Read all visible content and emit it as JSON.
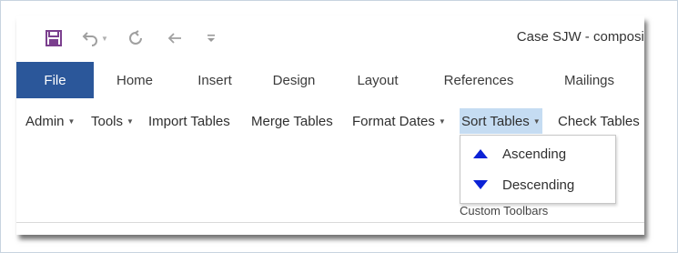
{
  "quick_access": {
    "title": "Case SJW - composit"
  },
  "tabs": [
    {
      "label": "File"
    },
    {
      "label": "Home"
    },
    {
      "label": "Insert"
    },
    {
      "label": "Design"
    },
    {
      "label": "Layout"
    },
    {
      "label": "References"
    },
    {
      "label": "Mailings"
    }
  ],
  "toolbar": {
    "items": [
      {
        "label": "Admin"
      },
      {
        "label": "Tools"
      },
      {
        "label": "Import Tables"
      },
      {
        "label": "Merge Tables"
      },
      {
        "label": "Format Dates"
      },
      {
        "label": "Sort Tables"
      },
      {
        "label": "Check Tables"
      }
    ],
    "group_label": "Custom Toolbars"
  },
  "sort_menu": {
    "items": [
      {
        "label": "Ascending",
        "icon": "triangle-up-icon"
      },
      {
        "label": "Descending",
        "icon": "triangle-down-icon"
      }
    ]
  },
  "colors": {
    "file_tab": "#2b579a",
    "active_highlight": "#c5dcf2",
    "sort_arrow": "#0b22d6"
  }
}
